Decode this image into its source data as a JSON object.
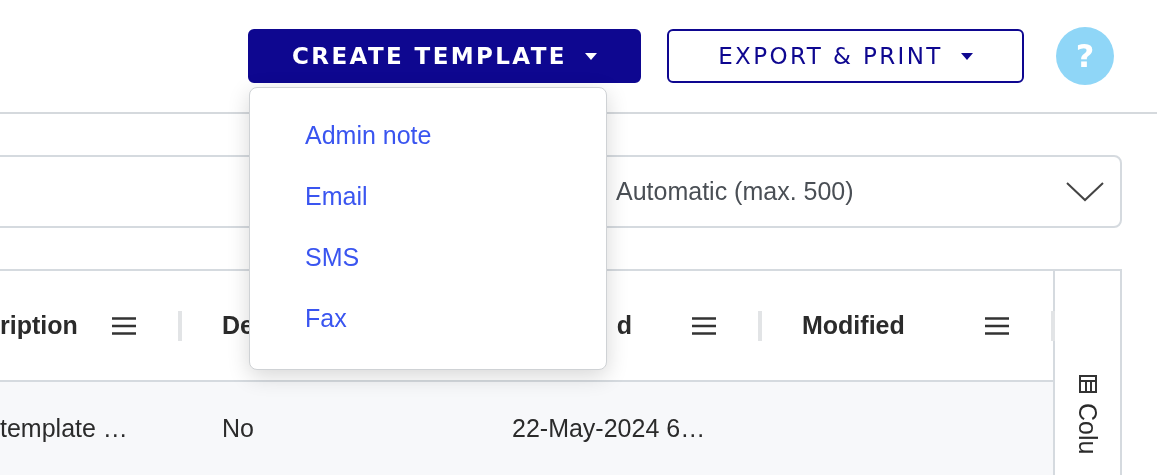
{
  "toolbar": {
    "create_button": {
      "label": "CREATE TEMPLATE",
      "expanded": true
    },
    "export_button": {
      "label": "EXPORT & PRINT"
    },
    "help_button": {
      "label": "?"
    }
  },
  "dropdown_menu": {
    "items": [
      "Admin note",
      "Email",
      "SMS",
      "Fax"
    ]
  },
  "row_limit_select": {
    "value": "Automatic (max. 500)"
  },
  "table": {
    "columns": [
      "ription",
      "De",
      "d",
      "Modified"
    ],
    "rows": [
      {
        "cells": [
          "template …",
          "No",
          "22-May-2024 6…"
        ]
      }
    ],
    "columns_panel": {
      "label": "Colu"
    }
  }
}
